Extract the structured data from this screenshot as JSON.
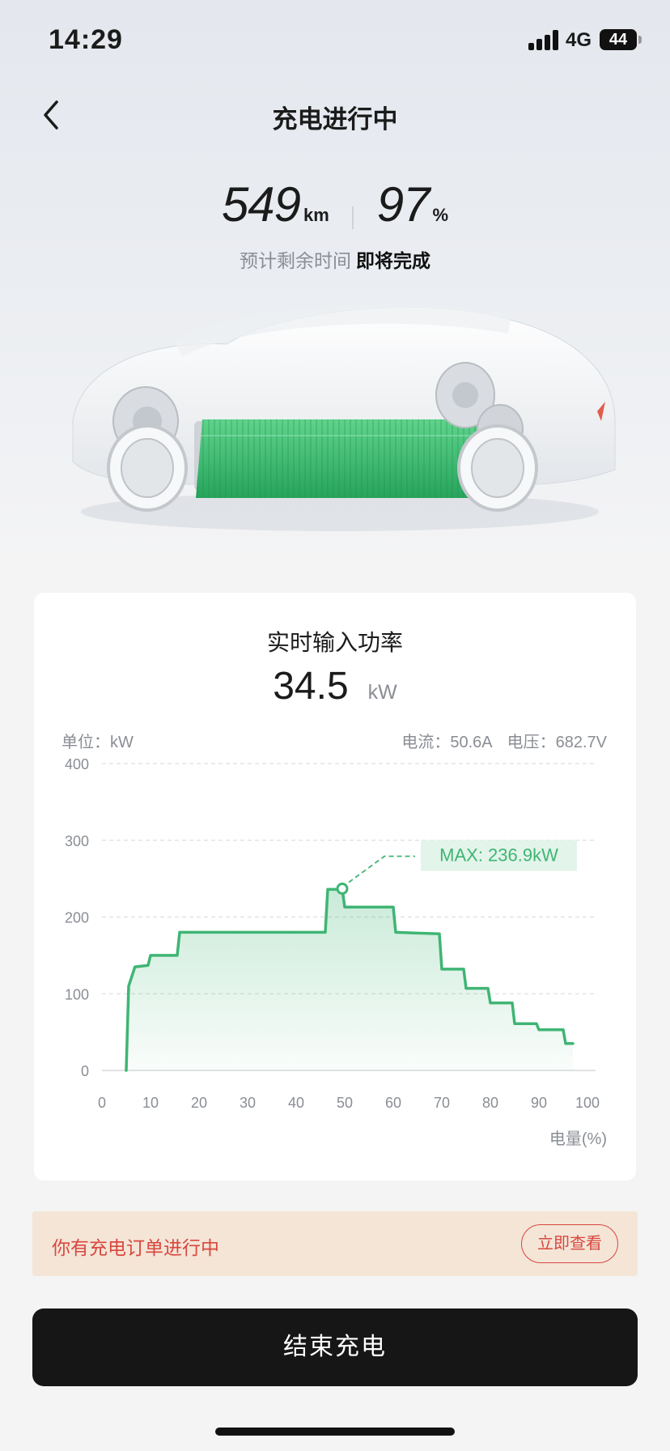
{
  "status_bar": {
    "time": "14:29",
    "network": "4G",
    "battery": "44"
  },
  "header": {
    "title": "充电进行中"
  },
  "summary": {
    "range_value": "549",
    "range_unit": "km",
    "soc_value": "97",
    "soc_unit": "%",
    "eta_label": "预计剩余时间",
    "eta_value": "即将完成"
  },
  "colors": {
    "accent_green": "#3fb574",
    "danger_red": "#d8483e",
    "notice_bg": "#f4e5d7"
  },
  "power_card": {
    "title": "实时输入功率",
    "power_value": "34.5",
    "power_unit": "kW",
    "unit_label": "单位：kW",
    "current_label": "电流：50.6A",
    "voltage_label": "电压：682.7V"
  },
  "chart_data": {
    "type": "area",
    "title": "",
    "xlabel": "电量(%)",
    "ylabel": "单位：kW",
    "xlim": [
      0,
      100
    ],
    "ylim": [
      0,
      400
    ],
    "x_ticks": [
      "0",
      "10",
      "20",
      "30",
      "40",
      "50",
      "60",
      "70",
      "80",
      "90",
      "100"
    ],
    "y_ticks": [
      "0",
      "100",
      "200",
      "300",
      "400"
    ],
    "grid": true,
    "max_label": "MAX: 236.9kW",
    "max_point": {
      "x": 49.5,
      "y": 236.9
    },
    "series": [
      {
        "x": [
          5,
          5.5,
          6.8,
          9.5,
          10,
          15.5,
          16,
          46,
          46.5,
          49.5,
          50,
          60,
          60.5,
          69.5,
          70,
          74.5,
          75,
          79.5,
          80,
          84.5,
          85,
          89.5,
          90,
          95,
          95.5,
          97
        ],
        "y": [
          0,
          110,
          135,
          137,
          150,
          150,
          180,
          180,
          236,
          236,
          213,
          213,
          180,
          178,
          132,
          132,
          107,
          107,
          88,
          88,
          61,
          61,
          53,
          53,
          35,
          35
        ]
      }
    ]
  },
  "notice": {
    "text": "你有充电订单进行中",
    "action": "立即查看"
  },
  "footer": {
    "end_label": "结束充电"
  }
}
